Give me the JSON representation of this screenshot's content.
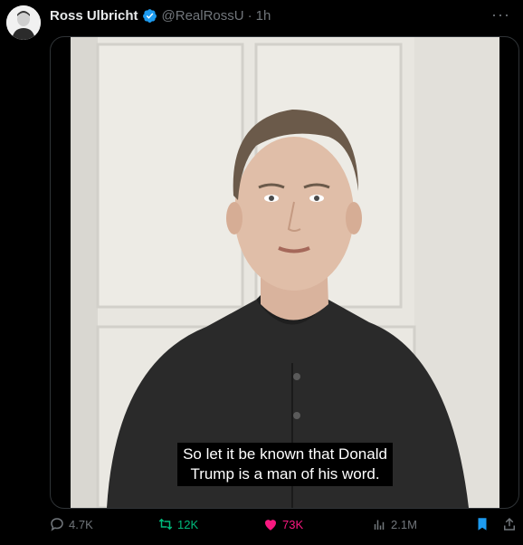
{
  "post": {
    "author_name": "Ross Ulbricht",
    "author_handle": "@RealRossU",
    "separator": "·",
    "time": "1h",
    "verified": true,
    "more": "···"
  },
  "video": {
    "caption": "So let it be known that Donald\nTrump is a man of his word."
  },
  "actions": {
    "replies": "4.7K",
    "reposts": "12K",
    "likes": "73K",
    "views": "2.1M",
    "reposted": true,
    "liked": true,
    "bookmarked": true
  },
  "colors": {
    "verified": "#1d9bf0",
    "repost": "#00ba7c",
    "like": "#f91880",
    "bookmark": "#1d9bf0",
    "muted": "#71767b"
  }
}
